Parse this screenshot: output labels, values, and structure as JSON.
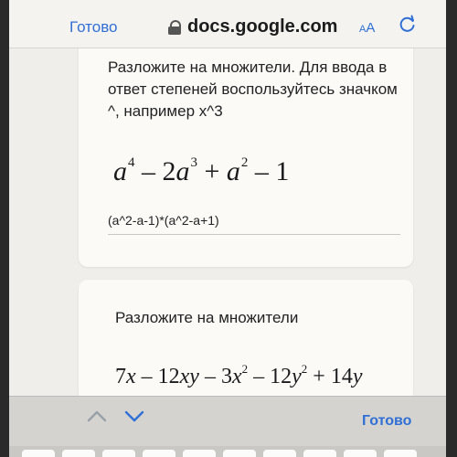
{
  "browser": {
    "done_label": "Готово",
    "url": "docs.google.com",
    "text_size_label": "AA",
    "reload_icon": "reload-icon",
    "lock_icon": "lock-icon"
  },
  "questions": [
    {
      "prompt": "Разложите на множители. Для ввода в ответ степеней воспользуйтесь значком ^, например x^3",
      "expression": "a⁴ − 2a³ + a² − 1",
      "answer": "(a^2-a-1)*(a^2-a+1)"
    },
    {
      "prompt": "Разложите на множители",
      "expression": "7x − 12xy − 3x² − 12y² + 14y"
    }
  ],
  "keyboard_bar": {
    "done_label": "Готово",
    "prev_icon": "chevron-up-icon",
    "next_icon": "chevron-down-icon"
  },
  "colors": {
    "accent": "#2f6fd6",
    "card": "#fbfaf7",
    "background": "#efeeea"
  }
}
